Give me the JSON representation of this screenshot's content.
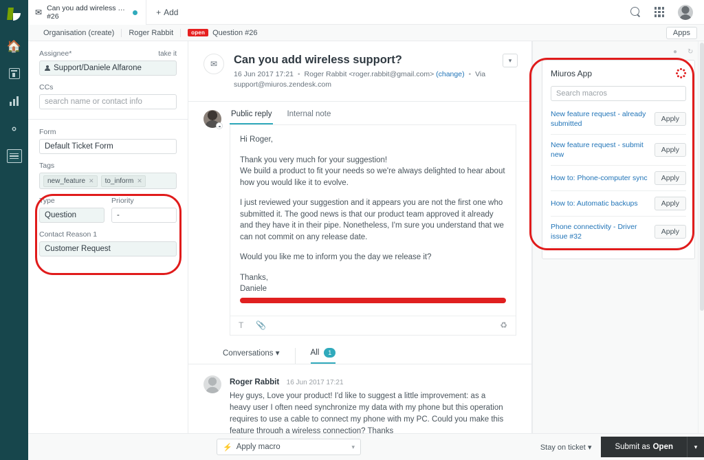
{
  "nav": {
    "logo_name": "zendesk-logo",
    "items": [
      {
        "name": "home",
        "icon": "home-icon"
      },
      {
        "name": "views",
        "icon": "views-icon"
      },
      {
        "name": "reporting",
        "icon": "bar-chart-icon"
      },
      {
        "name": "admin",
        "icon": "gear-icon"
      },
      {
        "name": "more",
        "icon": "menu-list-icon"
      }
    ]
  },
  "topbar": {
    "tab": {
      "title": "Can you add wireless suppo...",
      "subtitle": "#26",
      "icon": "mail-icon",
      "dot_color": "#30aabc"
    },
    "add_label": "Add",
    "icons": [
      "search-icon",
      "apps-grid-icon",
      "user-avatar"
    ]
  },
  "breadcrumb": {
    "items": [
      "Organisation (create)",
      "Roger Rabbit"
    ],
    "status_badge": "open",
    "current": "Question #26",
    "apps_button": "Apps"
  },
  "properties": {
    "assignee_label": "Assignee*",
    "take_it": "take it",
    "assignee_value": "Support/Daniele Alfarone",
    "ccs_label": "CCs",
    "ccs_placeholder": "search name or contact info",
    "form_label": "Form",
    "form_value": "Default Ticket Form",
    "tags_label": "Tags",
    "tags": [
      "new_feature",
      "to_inform"
    ],
    "type_label": "Type",
    "type_value": "Question",
    "priority_label": "Priority",
    "priority_value": "-",
    "contact_reason_label": "Contact Reason 1",
    "contact_reason_value": "Customer Request"
  },
  "ticket": {
    "icon": "mail-icon",
    "title": "Can you add wireless support?",
    "meta_date": "16 Jun 2017 17:21",
    "meta_requester": "Roger Rabbit <roger.rabbit@gmail.com>",
    "meta_change": "(change)",
    "meta_via": "Via",
    "meta_via_address": "support@miuros.zendesk.com",
    "caret": "chevron-down-icon"
  },
  "compose": {
    "tabs": [
      {
        "label": "Public reply",
        "selected": true
      },
      {
        "label": "Internal note",
        "selected": false
      }
    ],
    "paragraphs": [
      "Hi Roger,",
      "Thank you very much for your suggestion!\nWe build a product to fit your needs so we're always delighted to hear about how you would like it to evolve.",
      "I just reviewed your suggestion and it appears you are not the first one who submitted it. The good news is that our product team approved it already and they have it in their pipe. Nonetheless, I'm sure you understand that we can not commit on any release date.",
      "Would you like me to inform you the day we release it?",
      "Thanks,\nDaniele"
    ],
    "tools": [
      "text-format-icon",
      "attachment-icon",
      "cc-toggle-icon"
    ]
  },
  "conversations": {
    "selector_label": "Conversations",
    "all_label": "All",
    "all_count": "1",
    "messages": [
      {
        "author": "Roger Rabbit",
        "time": "16 Jun 2017 17:21",
        "text": "Hey guys, Love your product! I'd like to suggest a little improvement: as a heavy user I often need synchronize my data with my phone but this operation requires to use a cable to connect my phone with my PC. Could you make this feature through a wireless connection? Thanks"
      }
    ]
  },
  "app_panel": {
    "title": "Miuros App",
    "spinner": "loading-spinner",
    "search_placeholder": "Search macros",
    "apply_label": "Apply",
    "macros": [
      "New feature request - already submitted",
      "New feature request - submit new",
      "How to: Phone-computer sync",
      "How to: Automatic backups",
      "Phone connectivity - Driver issue #32"
    ]
  },
  "footer": {
    "apply_macro_label": "Apply macro",
    "stay_label": "Stay on ticket",
    "submit_prefix": "Submit as",
    "submit_state": "Open"
  },
  "annotations": {
    "highlight_color": "#e01b1b",
    "regions": [
      "tags-type-priority-contact-reason",
      "miuros-app-macros-panel"
    ]
  }
}
